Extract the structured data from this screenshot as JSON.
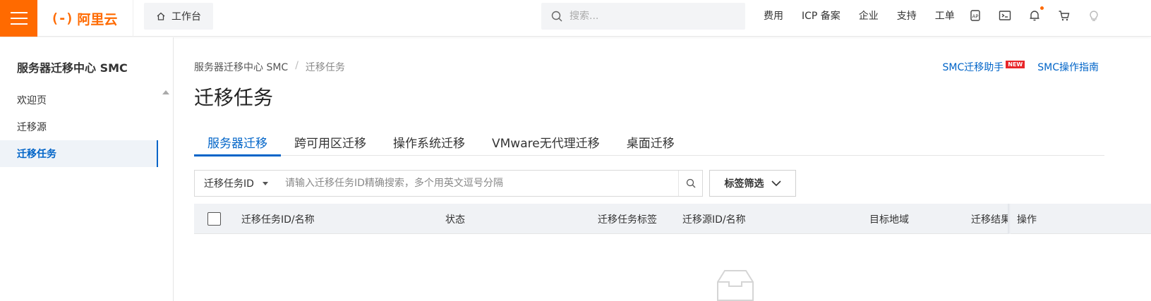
{
  "header": {
    "logo_mark": "(-)",
    "logo_text": "阿里云",
    "workbench_label": "工作台",
    "search_placeholder": "搜索...",
    "nav": [
      "费用",
      "ICP 备案",
      "企业",
      "支持",
      "工单"
    ],
    "icons": [
      "app-icon",
      "terminal-icon",
      "bell-icon",
      "cart-icon",
      "bulb-icon"
    ],
    "accent_color": "#ff6a00"
  },
  "sidebar": {
    "title": "服务器迁移中心 SMC",
    "items": [
      {
        "label": "欢迎页",
        "active": false
      },
      {
        "label": "迁移源",
        "active": false
      },
      {
        "label": "迁移任务",
        "active": true
      }
    ]
  },
  "main": {
    "breadcrumb": [
      "服务器迁移中心 SMC",
      "迁移任务"
    ],
    "breadcrumb_sep": "/",
    "links": {
      "assistant": "SMC迁移助手",
      "assistant_badge": "NEW",
      "guide": "SMC操作指南"
    },
    "title": "迁移任务",
    "tabs": [
      {
        "label": "服务器迁移",
        "active": true
      },
      {
        "label": "跨可用区迁移",
        "active": false
      },
      {
        "label": "操作系统迁移",
        "active": false
      },
      {
        "label": "VMware无代理迁移",
        "active": false
      },
      {
        "label": "桌面迁移",
        "active": false
      }
    ],
    "filter": {
      "select_value": "迁移任务ID",
      "placeholder": "请输入迁移任务ID精确搜索，多个用英文逗号分隔"
    },
    "tag_filter_label": "标签筛选",
    "table": {
      "columns": [
        "迁移任务ID/名称",
        "状态",
        "迁移任务标签",
        "迁移源ID/名称",
        "目标地域",
        "迁移结果",
        "操作"
      ]
    },
    "primary_color": "#0064c8"
  }
}
